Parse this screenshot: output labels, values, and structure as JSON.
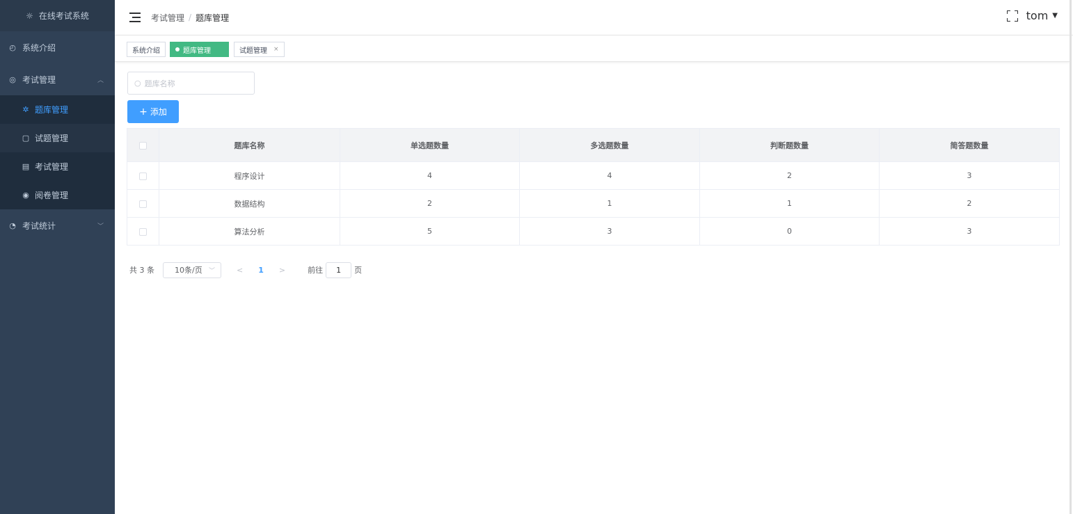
{
  "app": {
    "system_title": "在线考试系统"
  },
  "sidebar": {
    "items": [
      {
        "label": "系统介绍",
        "icon": "dashboard-icon"
      },
      {
        "label": "考试管理",
        "icon": "tablet-icon"
      },
      {
        "label": "考试统计",
        "icon": "pie-chart-icon"
      }
    ],
    "sub_items": [
      {
        "label": "题库管理",
        "icon": "question-bank-icon",
        "active": true
      },
      {
        "label": "试题管理",
        "icon": "edit-doc-icon"
      },
      {
        "label": "考试管理",
        "icon": "document-icon"
      },
      {
        "label": "阅卷管理",
        "icon": "eye-icon"
      }
    ]
  },
  "header": {
    "breadcrumb": [
      "考试管理",
      "题库管理"
    ],
    "breadcrumb_sep": "/",
    "username": "tom"
  },
  "tags": [
    {
      "label": "系统介绍",
      "active": false
    },
    {
      "label": "题库管理",
      "active": true
    },
    {
      "label": "试题管理",
      "active": false,
      "close": "×"
    }
  ],
  "toolbar": {
    "search_placeholder": "题库名称",
    "add_label": "添加",
    "add_plus": "+"
  },
  "table": {
    "columns": [
      "题库名称",
      "单选题数量",
      "多选题数量",
      "判断题数量",
      "简答题数量"
    ],
    "rows": [
      [
        "程序设计",
        "4",
        "4",
        "2",
        "3"
      ],
      [
        "数据结构",
        "2",
        "1",
        "1",
        "2"
      ],
      [
        "算法分析",
        "5",
        "3",
        "0",
        "3"
      ]
    ]
  },
  "pagination": {
    "total": "共 3 条",
    "page_size": "10条/页",
    "prev": "<",
    "current_page": "1",
    "next": ">",
    "goto_label": "前往",
    "goto_value": "1",
    "goto_unit": "页"
  },
  "colors": {
    "sidebar_bg": "#304156",
    "active_menu": "#409eff",
    "active_tag": "#42b983",
    "primary_button": "#409eff"
  }
}
